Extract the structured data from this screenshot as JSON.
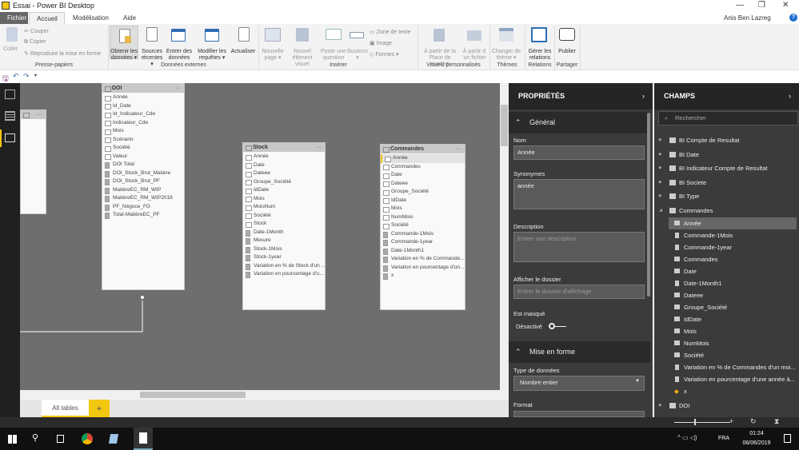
{
  "window": {
    "title": "Essai - Power BI Desktop",
    "user": "Anis Ben Lazreg"
  },
  "tabs": [
    "Fichier",
    "Accueil",
    "Modélisation",
    "Aide"
  ],
  "ribbon": {
    "clipboard": {
      "paste": "Coller",
      "cut": "Couper",
      "copy": "Copier",
      "format_painter": "Reproduire la mise en forme",
      "group": "Presse-papiers"
    },
    "external": {
      "get_data": [
        "Obtenir les",
        "données ▾"
      ],
      "recent": [
        "Sources",
        "récentes ▾"
      ],
      "enter": [
        "Entrer des",
        "données"
      ],
      "edit": [
        "Modifier les",
        "requêtes ▾"
      ],
      "refresh": [
        "Actualiser",
        ""
      ],
      "group": "Données externes"
    },
    "insert": {
      "new_page": [
        "Nouvelle",
        "page ▾"
      ],
      "new_visual": [
        "Nouvel",
        "élément visuel"
      ],
      "qa": [
        "Poser une",
        "question"
      ],
      "buttons": [
        "Boutons",
        "▾"
      ],
      "textbox": "Zone de texte",
      "image": "Image",
      "shapes": "Formes ▾",
      "group": "Insérer"
    },
    "custom": {
      "market": [
        "À partir de la",
        "Place de marché"
      ],
      "file": [
        "À partir d",
        "'un fichier"
      ],
      "group": "Visuels personnalisés"
    },
    "themes": {
      "switch": [
        "Changer de",
        "thème ▾"
      ],
      "group": "Thèmes"
    },
    "relations": {
      "manage": [
        "Gérer les",
        "relations"
      ],
      "group": "Relations"
    },
    "share": {
      "publish": [
        "Publier",
        ""
      ],
      "group": "Partager"
    }
  },
  "tables": [
    {
      "name": "",
      "fields": []
    },
    {
      "name": "DOI",
      "fields": [
        [
          "Année",
          0
        ],
        [
          "Id_Date",
          0
        ],
        [
          "Id_Indicateur_Cde",
          0
        ],
        [
          "Indicateur_Cde",
          0
        ],
        [
          "Mois",
          0
        ],
        [
          "Scénario",
          0
        ],
        [
          "Société",
          0
        ],
        [
          "Valeur",
          0
        ],
        [
          "DOI Total",
          1
        ],
        [
          "DOI_Stock_Brut_Matière",
          1
        ],
        [
          "DOI_Stock_Brut_PF",
          1
        ],
        [
          "MatièreEC_RM_WIP",
          1
        ],
        [
          "MatièreEC_RM_WIP2018",
          1
        ],
        [
          "PF_Négoce_FG",
          1
        ],
        [
          "Total-MatièreEC_PF",
          1
        ]
      ]
    },
    {
      "name": "Stock",
      "fields": [
        [
          "Année",
          0
        ],
        [
          "Date",
          0
        ],
        [
          "Dateee",
          0
        ],
        [
          "Groupe_Société",
          0
        ],
        [
          "IdDate",
          0
        ],
        [
          "Mois",
          0
        ],
        [
          "MoisNum",
          0
        ],
        [
          "Société",
          0
        ],
        [
          "Stock",
          0
        ],
        [
          "Date-1Month",
          1
        ],
        [
          "Mesure",
          1
        ],
        [
          "Stock-1Mois",
          1
        ],
        [
          "Stock-1year",
          1
        ],
        [
          "Variation en % de Stock d'un ...",
          1
        ],
        [
          "Variation en pourcentage d'u...",
          1
        ]
      ]
    },
    {
      "name": "Commandes",
      "fields": [
        [
          "Année",
          0
        ],
        [
          "Commandes",
          0
        ],
        [
          "Date",
          0
        ],
        [
          "Dateee",
          0
        ],
        [
          "Groupe_Société",
          0
        ],
        [
          "IdDate",
          0
        ],
        [
          "Mois",
          0
        ],
        [
          "NumMois",
          0
        ],
        [
          "Société",
          0
        ],
        [
          "Commande-1Mois",
          1
        ],
        [
          "Commande-1year",
          1
        ],
        [
          "Date-1Month1",
          1
        ],
        [
          "Variation en % de Commande...",
          1
        ],
        [
          "Variation en pourcentage d'un...",
          1
        ],
        [
          "x",
          1
        ]
      ]
    }
  ],
  "page_tabs": {
    "all": "All tables",
    "add": "+"
  },
  "properties": {
    "title": "PROPRIÉTÉS",
    "general": "Général",
    "name_label": "Nom",
    "name_value": "Année",
    "syn_label": "Synonymes",
    "syn_value": "année",
    "desc_label": "Description",
    "desc_ph": "Entrer une description",
    "folder_label": "Afficher le dossier",
    "folder_ph": "Entrer le dossier d'affichage",
    "hidden_label": "Est masqué",
    "hidden_state": "Désactivé",
    "hidden_on": false,
    "format_section": "Mise en forme",
    "type_label": "Type de données",
    "type_value": "Nombre entier",
    "format_label": "Format"
  },
  "fields": {
    "title": "CHAMPS",
    "search_ph": "Rechercher",
    "tables": [
      "BI Compte de Resultat",
      "BI Date",
      "BI Indicateur Compte de Resultat",
      "BI Societe",
      "BI Type",
      "Commandes"
    ],
    "commandes": [
      [
        "Année",
        0
      ],
      [
        "Commande-1Mois",
        1
      ],
      [
        "Commande-1year",
        1
      ],
      [
        "Commandes",
        0
      ],
      [
        "Date",
        0
      ],
      [
        "Date-1Month1",
        1
      ],
      [
        "Dateee",
        0
      ],
      [
        "Groupe_Société",
        0
      ],
      [
        "IdDate",
        0
      ],
      [
        "Mois",
        0
      ],
      [
        "NumMois",
        0
      ],
      [
        "Société",
        0
      ],
      [
        "Variation en % de Commandes d'un moi...",
        1
      ],
      [
        "Variation en pourcentage d'une année à...",
        1
      ],
      [
        "x",
        2
      ]
    ],
    "after": [
      "DOI"
    ]
  },
  "taskbar": {
    "time": "01:24",
    "date": "06/06/2019",
    "lang": "FRA"
  },
  "colors": {
    "accent": "#f2c811",
    "dark": "#3b3b3b"
  }
}
